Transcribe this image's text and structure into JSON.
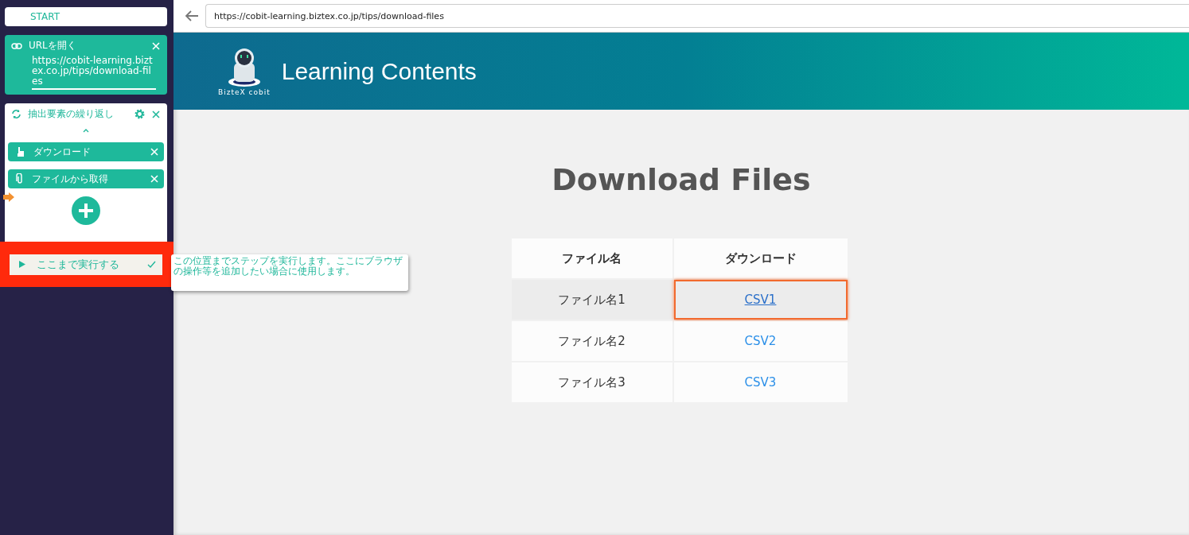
{
  "sidebar": {
    "start": "START",
    "url_step": {
      "title": "URLを開く",
      "value": "https://cobit-learning.biztex.co.jp/tips/download-files"
    },
    "loop_step": {
      "title": "抽出要素の繰り返し",
      "expanded": true,
      "children": [
        {
          "kind": "click",
          "label": "ダウンロード"
        },
        {
          "kind": "file",
          "label": "ファイルから取得"
        }
      ]
    },
    "run_here": {
      "label": "ここまで実行する",
      "checked": true
    },
    "tooltip": "この位置までステップを実行します。ここにブラウザの操作等を追加したい場合に使用します。"
  },
  "browser": {
    "address": "https://cobit-learning.biztex.co.jp/tips/download-files"
  },
  "header": {
    "brand": "BizteX cobit",
    "title": "Learning Contents"
  },
  "page": {
    "title": "Download Files",
    "table": {
      "columns": [
        "ファイル名",
        "ダウンロード"
      ],
      "rows": [
        {
          "name": "ファイル名1",
          "link": "CSV1",
          "selected": true
        },
        {
          "name": "ファイル名2",
          "link": "CSV2",
          "selected": false
        },
        {
          "name": "ファイル名3",
          "link": "CSV3",
          "selected": false
        }
      ]
    }
  }
}
